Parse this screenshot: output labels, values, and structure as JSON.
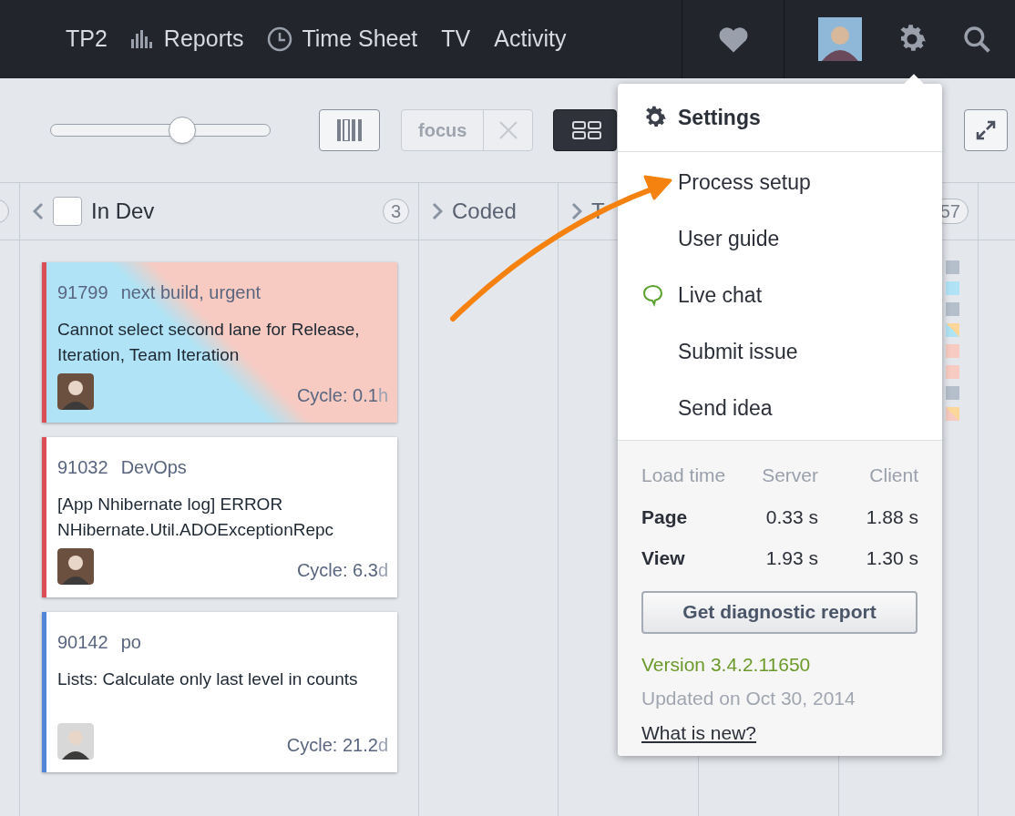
{
  "nav": {
    "items": [
      {
        "label": "TP2",
        "kind": "text"
      },
      {
        "label": "Reports",
        "kind": "chart"
      },
      {
        "label": "Time Sheet",
        "kind": "clock"
      },
      {
        "label": "TV",
        "kind": "text"
      },
      {
        "label": "Activity",
        "kind": "text"
      }
    ]
  },
  "toolbar": {
    "zoom": {
      "level": 0.6
    },
    "focus": {
      "label": "focus",
      "disabled": true
    }
  },
  "columns": [
    {
      "title": "In Dev",
      "kind": "current",
      "checked": false,
      "count": "3"
    },
    {
      "title": "Coded",
      "kind": "next"
    },
    {
      "title": "T",
      "kind": "next"
    }
  ],
  "last_column": {
    "count": "57",
    "mini_cards": [
      {
        "color": "#b4bfcb",
        "kind": "plain"
      },
      {
        "color": "#b0e3f5",
        "kind": "plain"
      },
      {
        "color": "#b4bfcb",
        "kind": "plain"
      },
      {
        "color": "#b0e3f5",
        "kind": "split"
      },
      {
        "color": "#f7cbc1",
        "kind": "plain"
      },
      {
        "color": "#f7cbc1",
        "kind": "plain"
      },
      {
        "color": "#b4bfcb",
        "kind": "plain"
      },
      {
        "color": "#f7cbc1",
        "kind": "split"
      }
    ]
  },
  "cards": [
    {
      "id": "91799",
      "tags": "next build, urgent",
      "title": "Cannot select second lane for Release, Iteration, Team Iteration",
      "color": "#d94f55",
      "kind": "split",
      "cycle_label": "Cycle:",
      "cycle_value": "0.1",
      "cycle_unit": "h"
    },
    {
      "id": "91032",
      "tags": "DevOps",
      "title": "[App Nhibernate log] ERROR NHibernate.Util.ADOExceptionRepc",
      "color": "#d94f55",
      "kind": "plain",
      "cycle_label": "Cycle:",
      "cycle_value": "6.3",
      "cycle_unit": "d"
    },
    {
      "id": "90142",
      "tags": "po",
      "title": "Lists: Calculate only last level in counts",
      "color": "#4f86d9",
      "kind": "plain",
      "cycle_label": "Cycle:",
      "cycle_value": "21.2",
      "cycle_unit": "d"
    }
  ],
  "settings_menu": {
    "title": "Settings",
    "items": [
      {
        "label": "Process setup",
        "kind": "plain"
      },
      {
        "label": "User guide",
        "kind": "plain"
      },
      {
        "label": "Live chat",
        "kind": "chat"
      },
      {
        "label": "Submit issue",
        "kind": "plain"
      },
      {
        "label": "Send idea",
        "kind": "plain"
      }
    ],
    "load_table": {
      "columns": [
        "Load time",
        "Server",
        "Client"
      ],
      "rows": [
        {
          "name": "Page",
          "server": "0.33 s",
          "client": "1.88 s"
        },
        {
          "name": "View",
          "server": "1.93 s",
          "client": "1.30 s"
        }
      ]
    },
    "button": "Get diagnostic report",
    "version": "Version 3.4.2.11650",
    "updated": "Updated on Oct 30, 2014",
    "link": "What is new?"
  }
}
